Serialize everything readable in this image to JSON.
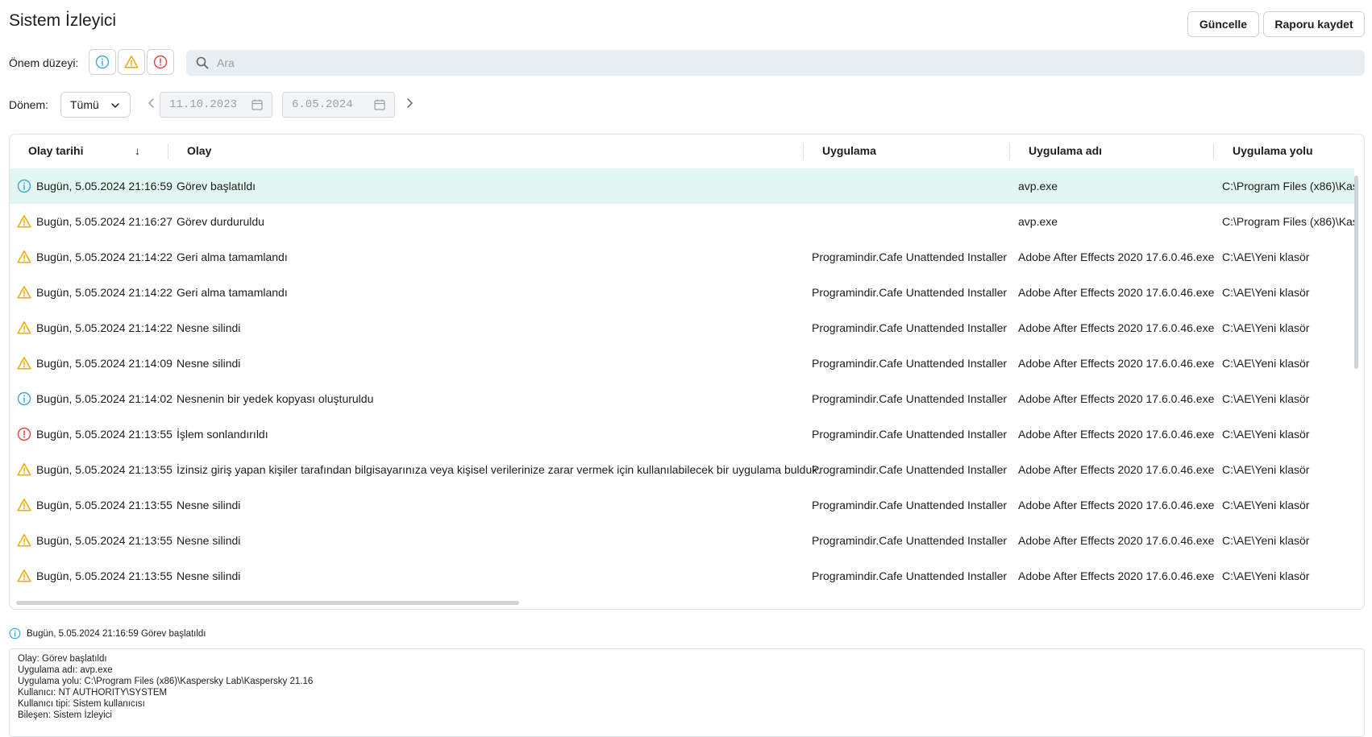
{
  "header": {
    "title": "Sistem İzleyici",
    "refresh_label": "Güncelle",
    "save_report_label": "Raporu kaydet"
  },
  "filters": {
    "severity_label": "Önem düzeyi:",
    "search_placeholder": "Ara",
    "period_label": "Dönem:",
    "period_value": "Tümü",
    "date_from": "11.10.2023",
    "date_to": "6.05.2024"
  },
  "colors": {
    "info": "#3ba8d9",
    "warning": "#f2a900",
    "error": "#e5413b",
    "selected_row": "#e2f6f2"
  },
  "table": {
    "columns": [
      "Olay tarihi",
      "Olay",
      "Uygulama",
      "Uygulama adı",
      "Uygulama yolu"
    ],
    "sort_indicator": "↓",
    "rows": [
      {
        "severity": "info",
        "date": "Bugün, 5.05.2024 21:16:59",
        "event": "Görev başlatıldı",
        "app": "",
        "app_name": "avp.exe",
        "app_path": "C:\\Program Files (x86)\\Kas"
      },
      {
        "severity": "warning",
        "date": "Bugün, 5.05.2024 21:16:27",
        "event": "Görev durduruldu",
        "app": "",
        "app_name": "avp.exe",
        "app_path": "C:\\Program Files (x86)\\Kas"
      },
      {
        "severity": "warning",
        "date": "Bugün, 5.05.2024 21:14:22",
        "event": "Geri alma tamamlandı",
        "app": "Programindir.Cafe Unattended Installer",
        "app_name": "Adobe After Effects 2020 17.6.0.46.exe",
        "app_path": "C:\\AE\\Yeni klasör"
      },
      {
        "severity": "warning",
        "date": "Bugün, 5.05.2024 21:14:22",
        "event": "Geri alma tamamlandı",
        "app": "Programindir.Cafe Unattended Installer",
        "app_name": "Adobe After Effects 2020 17.6.0.46.exe",
        "app_path": "C:\\AE\\Yeni klasör"
      },
      {
        "severity": "warning",
        "date": "Bugün, 5.05.2024 21:14:22",
        "event": "Nesne silindi",
        "app": "Programindir.Cafe Unattended Installer",
        "app_name": "Adobe After Effects 2020 17.6.0.46.exe",
        "app_path": "C:\\AE\\Yeni klasör"
      },
      {
        "severity": "warning",
        "date": "Bugün, 5.05.2024 21:14:09",
        "event": "Nesne silindi",
        "app": "Programindir.Cafe Unattended Installer",
        "app_name": "Adobe After Effects 2020 17.6.0.46.exe",
        "app_path": "C:\\AE\\Yeni klasör"
      },
      {
        "severity": "info",
        "date": "Bugün, 5.05.2024 21:14:02",
        "event": "Nesnenin bir yedek kopyası oluşturuldu",
        "app": "Programindir.Cafe Unattended Installer",
        "app_name": "Adobe After Effects 2020 17.6.0.46.exe",
        "app_path": "C:\\AE\\Yeni klasör"
      },
      {
        "severity": "error",
        "date": "Bugün, 5.05.2024 21:13:55",
        "event": "İşlem sonlandırıldı",
        "app": "Programindir.Cafe Unattended Installer",
        "app_name": "Adobe After Effects 2020 17.6.0.46.exe",
        "app_path": "C:\\AE\\Yeni klasör"
      },
      {
        "severity": "warning",
        "date": "Bugün, 5.05.2024 21:13:55",
        "event": "İzinsiz giriş yapan kişiler tarafından bilgisayarınıza veya kişisel verilerinize zarar vermek için kullanılabilecek bir uygulama bulduk.",
        "app": "Programindir.Cafe Unattended Installer",
        "app_name": "Adobe After Effects 2020 17.6.0.46.exe",
        "app_path": "C:\\AE\\Yeni klasör"
      },
      {
        "severity": "warning",
        "date": "Bugün, 5.05.2024 21:13:55",
        "event": "Nesne silindi",
        "app": "Programindir.Cafe Unattended Installer",
        "app_name": "Adobe After Effects 2020 17.6.0.46.exe",
        "app_path": "C:\\AE\\Yeni klasör"
      },
      {
        "severity": "warning",
        "date": "Bugün, 5.05.2024 21:13:55",
        "event": "Nesne silindi",
        "app": "Programindir.Cafe Unattended Installer",
        "app_name": "Adobe After Effects 2020 17.6.0.46.exe",
        "app_path": "C:\\AE\\Yeni klasör"
      },
      {
        "severity": "warning",
        "date": "Bugün, 5.05.2024 21:13:55",
        "event": "Nesne silindi",
        "app": "Programindir.Cafe Unattended Installer",
        "app_name": "Adobe After Effects 2020 17.6.0.46.exe",
        "app_path": "C:\\AE\\Yeni klasör"
      }
    ]
  },
  "detail": {
    "summary": "Bugün, 5.05.2024 21:16:59 Görev başlatıldı",
    "lines": [
      "Olay: Görev başlatıldı",
      "Uygulama adı: avp.exe",
      "Uygulama yolu: C:\\Program Files (x86)\\Kaspersky Lab\\Kaspersky 21.16",
      "Kullanıcı: NT AUTHORITY\\SYSTEM",
      "Kullanıcı tipi: Sistem kullanıcısı",
      "Bileşen: Sistem İzleyici"
    ]
  }
}
